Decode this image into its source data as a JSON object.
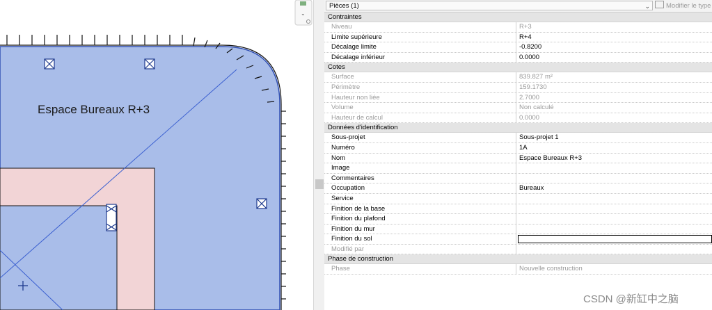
{
  "canvas": {
    "room_label": "Espace Bureaux R+3",
    "colors": {
      "room_fill": "#a9bde9",
      "room_edge": "#2f4fb3",
      "wall_fill": "#f2d4d6",
      "tag_stroke": "#1f3b8f"
    }
  },
  "properties": {
    "type_selector": "Pièces (1)",
    "edit_type_label": "Modifier le type",
    "sections": [
      {
        "title": "Contraintes",
        "rows": [
          {
            "label": "Niveau",
            "value": "R+3",
            "readonly": true
          },
          {
            "label": "Limite supérieure",
            "value": "R+4",
            "readonly": false
          },
          {
            "label": "Décalage limite",
            "value": "-0.8200",
            "readonly": false
          },
          {
            "label": "Décalage inférieur",
            "value": "0.0000",
            "readonly": false
          }
        ]
      },
      {
        "title": "Cotes",
        "rows": [
          {
            "label": "Surface",
            "value": "839.827 m²",
            "readonly": true
          },
          {
            "label": "Périmètre",
            "value": "159.1730",
            "readonly": true
          },
          {
            "label": "Hauteur non liée",
            "value": "2.7000",
            "readonly": true
          },
          {
            "label": "Volume",
            "value": "Non calculé",
            "readonly": true
          },
          {
            "label": "Hauteur de calcul",
            "value": "0.0000",
            "readonly": true
          }
        ]
      },
      {
        "title": "Données d'identification",
        "rows": [
          {
            "label": "Sous-projet",
            "value": "Sous-projet 1",
            "readonly": false
          },
          {
            "label": "Numéro",
            "value": "1A",
            "readonly": false
          },
          {
            "label": "Nom",
            "value": "Espace Bureaux R+3",
            "readonly": false
          },
          {
            "label": "Image",
            "value": "",
            "readonly": false
          },
          {
            "label": "Commentaires",
            "value": "",
            "readonly": false
          },
          {
            "label": "Occupation",
            "value": "Bureaux",
            "readonly": false
          },
          {
            "label": "Service",
            "value": "",
            "readonly": false
          },
          {
            "label": "Finition de la base",
            "value": "",
            "readonly": false
          },
          {
            "label": "Finition du plafond",
            "value": "",
            "readonly": false
          },
          {
            "label": "Finition du mur",
            "value": "",
            "readonly": false
          },
          {
            "label": "Finition du sol",
            "value": "",
            "readonly": false,
            "editing": true
          },
          {
            "label": "Modifié par",
            "value": "",
            "readonly": true
          }
        ]
      },
      {
        "title": "Phase de construction",
        "rows": [
          {
            "label": "Phase",
            "value": "Nouvelle construction",
            "readonly": true
          }
        ]
      }
    ]
  },
  "watermark": "CSDN @新缸中之脑"
}
